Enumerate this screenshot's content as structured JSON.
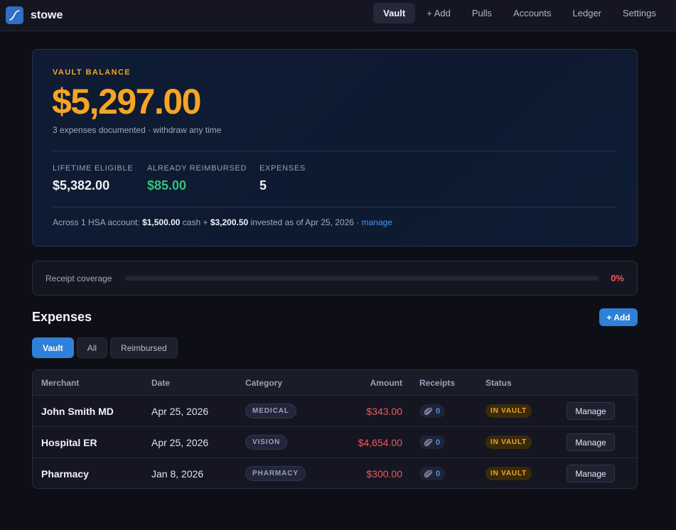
{
  "app": {
    "name": "stowe"
  },
  "nav": [
    {
      "label": "Vault",
      "active": true
    },
    {
      "label": "+ Add"
    },
    {
      "label": "Pulls"
    },
    {
      "label": "Accounts"
    },
    {
      "label": "Ledger"
    },
    {
      "label": "Settings"
    }
  ],
  "vault": {
    "label": "VAULT BALANCE",
    "amount": "$5,297.00",
    "subtitle": "3 expenses documented · withdraw any time",
    "stats": [
      {
        "label": "LIFETIME ELIGIBLE",
        "value": "$5,382.00"
      },
      {
        "label": "ALREADY REIMBURSED",
        "value": "$85.00"
      },
      {
        "label": "EXPENSES",
        "value": "5"
      }
    ],
    "hsa": {
      "prefix": "Across 1 HSA account: ",
      "cash": "$1,500.00",
      "cash_suffix": " cash + ",
      "invested": "$3,200.50",
      "invested_suffix": " invested as of Apr 25, 2026 · ",
      "manage_link": "manage"
    }
  },
  "coverage": {
    "label": "Receipt coverage",
    "percent_text": "0%",
    "percent": 0
  },
  "expenses": {
    "title": "Expenses",
    "add_label": "+ Add",
    "filters": [
      {
        "label": "Vault",
        "active": true
      },
      {
        "label": "All"
      },
      {
        "label": "Reimbursed"
      }
    ],
    "columns": {
      "merchant": "Merchant",
      "date": "Date",
      "category": "Category",
      "amount": "Amount",
      "receipts": "Receipts",
      "status": "Status"
    },
    "rows": [
      {
        "merchant": "John Smith MD",
        "date": "Apr 25, 2026",
        "category": "MEDICAL",
        "amount": "$343.00",
        "receipts": "0",
        "status": "IN VAULT",
        "action": "Manage"
      },
      {
        "merchant": "Hospital ER",
        "date": "Apr 25, 2026",
        "category": "VISION",
        "amount": "$4,654.00",
        "receipts": "0",
        "status": "IN VAULT",
        "action": "Manage"
      },
      {
        "merchant": "Pharmacy",
        "date": "Jan 8, 2026",
        "category": "PHARMACY",
        "amount": "$300.00",
        "receipts": "0",
        "status": "IN VAULT",
        "action": "Manage"
      }
    ]
  },
  "colors": {
    "accent": "#f5a524",
    "primary": "#2f80d8",
    "success": "#34c27a",
    "danger": "#ee5a5a",
    "background": "#0e0f16"
  },
  "icons": {
    "logo": "curve-logo-icon",
    "receipt": "paperclip-icon"
  }
}
